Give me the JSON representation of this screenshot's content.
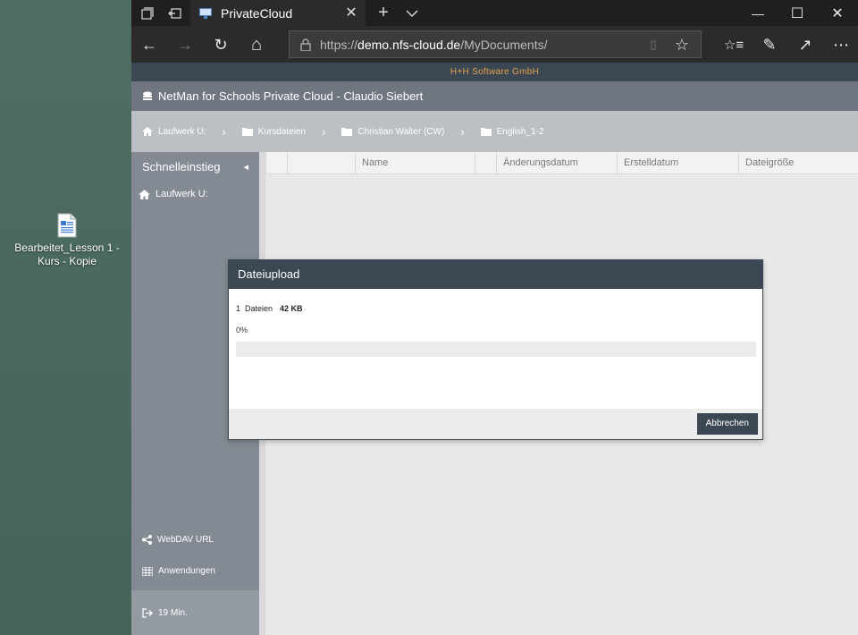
{
  "desktop": {
    "icon_label": "Bearbeitet_Lesson 1 - Kurs - Kopie"
  },
  "browser": {
    "tab_title": "PrivateCloud",
    "url_prefix": "https://",
    "url_domain": "demo.nfs-cloud.de",
    "url_path": "/MyDocuments/",
    "icons": {
      "tab_actions": "tab-actions-icon",
      "set_aside": "set-aside-tabs-icon",
      "new_tab": "+",
      "tab_list": "⌄",
      "close_tab": "✕",
      "minimize": "—",
      "maximize": "☐",
      "close_window": "✕",
      "back": "←",
      "forward": "→",
      "refresh": "↻",
      "home": "⌂",
      "reading_view": "▯",
      "favorite": "☆",
      "favorites_hub": "☆≡",
      "notes": "✎",
      "share": "↗",
      "more": "⋯"
    }
  },
  "app": {
    "brand": "H+H Software GmbH",
    "title": "NetMan for Schools Private Cloud - Claudio Siebert",
    "breadcrumbs": [
      "Laufwerk U:",
      "Kursdateien",
      "Christian Walter (CW)",
      "English_1-2"
    ],
    "breadcrumb_sep": "›",
    "sidebar": {
      "header": "Schnelleinstieg",
      "collapse": "◂",
      "items": [
        "Laufwerk U:"
      ],
      "webdav": "WebDAV URL",
      "apps": "Anwendungen",
      "timer": "19 Min."
    },
    "columns": [
      "Name",
      "Änderungsdatum",
      "Erstelldatum",
      "Dateigröße"
    ]
  },
  "dialog": {
    "title": "Dateiupload",
    "file_count": "1",
    "files_label": "Dateien",
    "total_size": "42 KB",
    "percent_text": "0%",
    "progress": 0,
    "cancel_label": "Abbrechen"
  }
}
